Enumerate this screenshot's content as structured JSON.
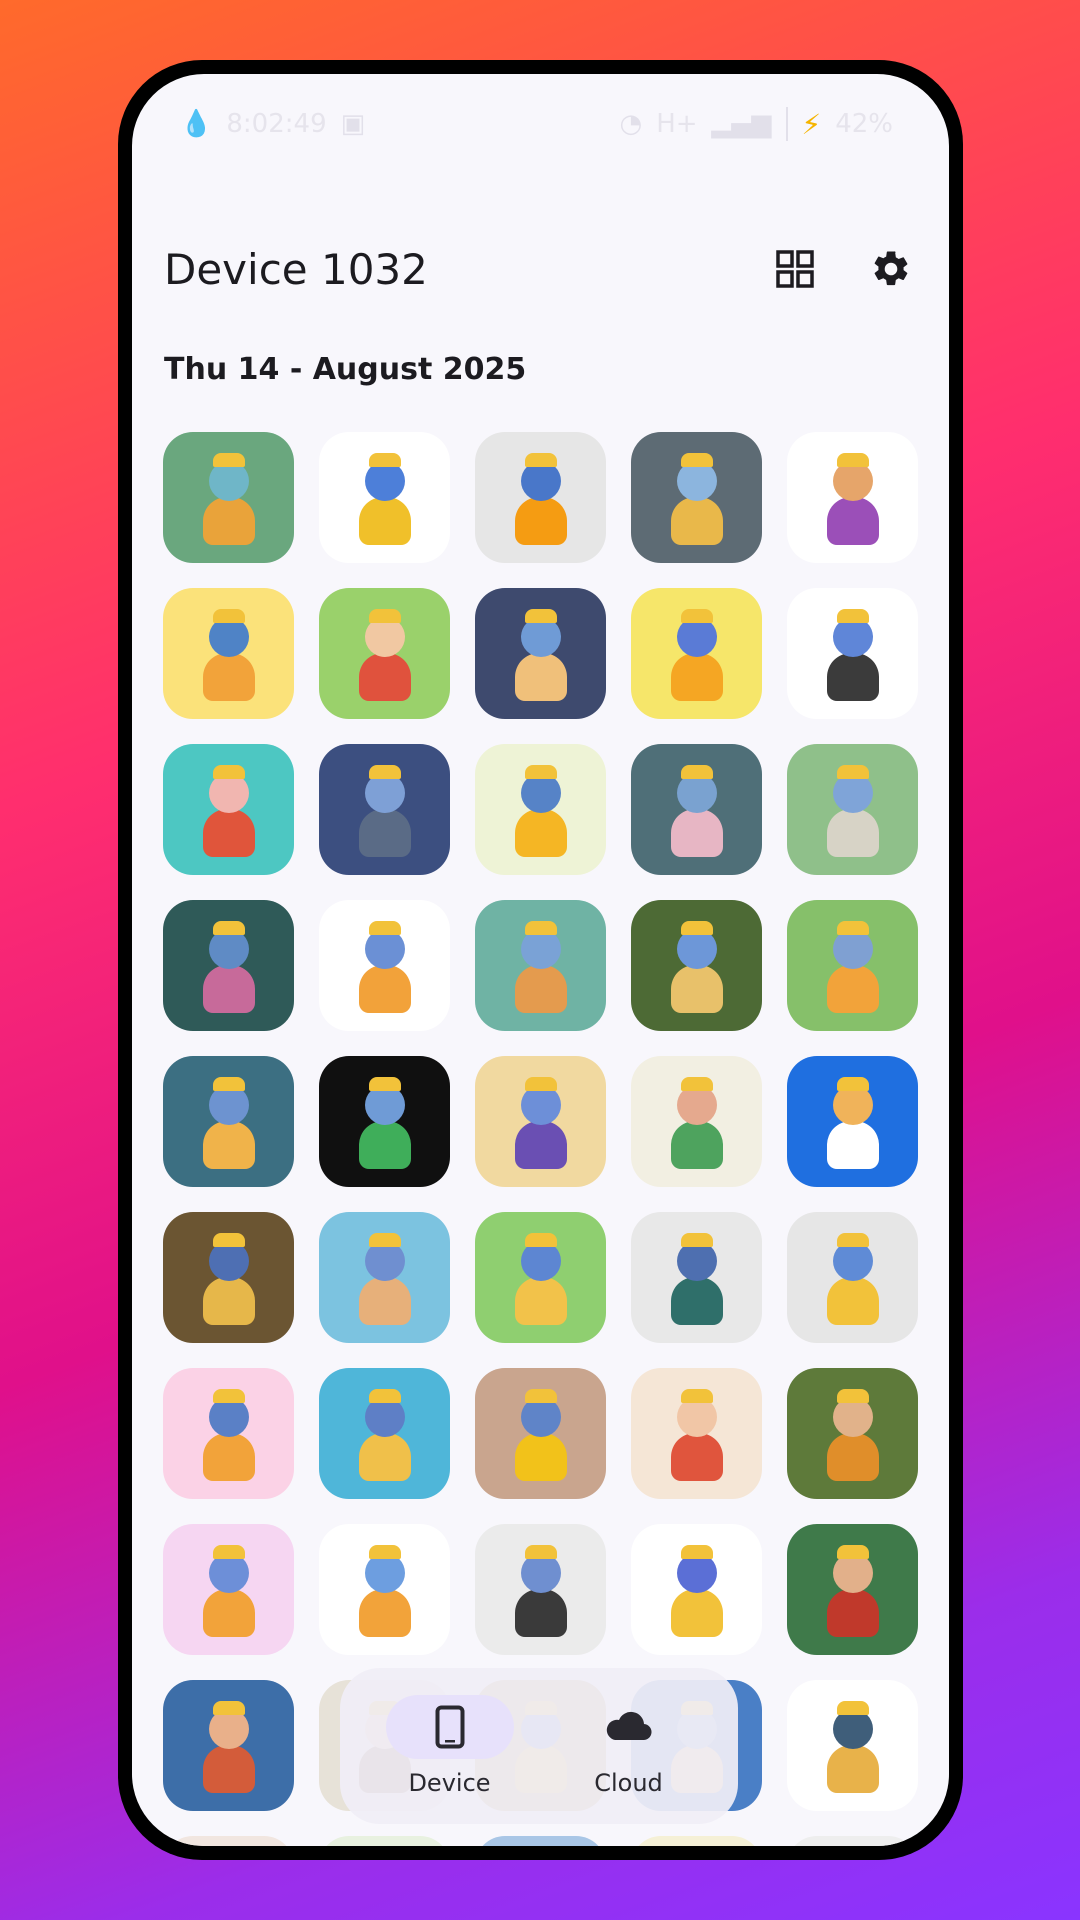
{
  "status_bar": {
    "time": "8:02:49",
    "network": "H+",
    "battery": "42%"
  },
  "app_bar": {
    "title": "Device 1032",
    "icons": [
      "grid-view-icon",
      "settings-gear-icon"
    ]
  },
  "date_group": {
    "header": "Thu 14 - August 2025"
  },
  "thumbnails": [
    {
      "bg": "#6aa77e",
      "skin": "#6fb6c8",
      "cloth": "#e9a33a"
    },
    {
      "bg": "#ffffff",
      "skin": "#4d7fd9",
      "cloth": "#f0c02a"
    },
    {
      "bg": "#e6e6e6",
      "skin": "#4977c9",
      "cloth": "#f59c12"
    },
    {
      "bg": "#5d6b74",
      "skin": "#8cb5de",
      "cloth": "#e9b84a"
    },
    {
      "bg": "#ffffff",
      "skin": "#e6a56a",
      "cloth": "#9b4fb8"
    },
    {
      "bg": "#fbe27a",
      "skin": "#4f83c6",
      "cloth": "#f2a33a"
    },
    {
      "bg": "#9ad16b",
      "skin": "#f1c8a2",
      "cloth": "#e0523d"
    },
    {
      "bg": "#3e4a6e",
      "skin": "#6f9bd6",
      "cloth": "#f0c07a"
    },
    {
      "bg": "#f6e66a",
      "skin": "#5a7bd6",
      "cloth": "#f5a623"
    },
    {
      "bg": "#ffffff",
      "skin": "#5f86d8",
      "cloth": "#3b3b3b"
    },
    {
      "bg": "#4dc7c2",
      "skin": "#f1b6b0",
      "cloth": "#e0553b"
    },
    {
      "bg": "#3c4f80",
      "skin": "#7ea0d6",
      "cloth": "#5a6b86"
    },
    {
      "bg": "#eef3d6",
      "skin": "#5683c7",
      "cloth": "#f5b624"
    },
    {
      "bg": "#4f6f78",
      "skin": "#7aa2d0",
      "cloth": "#e7b6c4"
    },
    {
      "bg": "#8fc08a",
      "skin": "#7fa4d8",
      "cloth": "#d7d3c6"
    },
    {
      "bg": "#2f5a58",
      "skin": "#5f8bc5",
      "cloth": "#c76a9a"
    },
    {
      "bg": "#ffffff",
      "skin": "#6b90d5",
      "cloth": "#f2a23a"
    },
    {
      "bg": "#6fb3a4",
      "skin": "#7aa2d6",
      "cloth": "#e49b4e"
    },
    {
      "bg": "#4d6a35",
      "skin": "#6d97d8",
      "cloth": "#e8c16a"
    },
    {
      "bg": "#86c06a",
      "skin": "#7fa0d2",
      "cloth": "#f2a33a"
    },
    {
      "bg": "#3c6f82",
      "skin": "#6d93d0",
      "cloth": "#f0b34a"
    },
    {
      "bg": "#101010",
      "skin": "#6f9bd6",
      "cloth": "#3fae5a"
    },
    {
      "bg": "#f1d9a0",
      "skin": "#6d8fd8",
      "cloth": "#6a4fb3"
    },
    {
      "bg": "#f2efe2",
      "skin": "#e5a98e",
      "cloth": "#4ea35e"
    },
    {
      "bg": "#1f6fe0",
      "skin": "#f0b35a",
      "cloth": "#ffffff"
    },
    {
      "bg": "#6b5532",
      "skin": "#4e6fb3",
      "cloth": "#e6b74a"
    },
    {
      "bg": "#7cc3e0",
      "skin": "#6f8fd0",
      "cloth": "#e7b07a"
    },
    {
      "bg": "#8fcf70",
      "skin": "#5d86d2",
      "cloth": "#f2c24a"
    },
    {
      "bg": "#e8e8e8",
      "skin": "#4e6fb0",
      "cloth": "#2f6f6a"
    },
    {
      "bg": "#e6e6e6",
      "skin": "#5f8bd6",
      "cloth": "#f2c23a"
    },
    {
      "bg": "#fbd2e6",
      "skin": "#5a80c6",
      "cloth": "#f2a33a"
    },
    {
      "bg": "#4fb6d9",
      "skin": "#5e7fc6",
      "cloth": "#f0c04a"
    },
    {
      "bg": "#c9a58e",
      "skin": "#5f84c8",
      "cloth": "#f2c21a"
    },
    {
      "bg": "#f5e6d6",
      "skin": "#f1c6a6",
      "cloth": "#e0553d"
    },
    {
      "bg": "#5e7a3a",
      "skin": "#e1b28a",
      "cloth": "#e08e2a"
    },
    {
      "bg": "#f6d6f2",
      "skin": "#6d8fd8",
      "cloth": "#f2a33a"
    },
    {
      "bg": "#ffffff",
      "skin": "#6d9ee0",
      "cloth": "#f2a33a"
    },
    {
      "bg": "#ebebeb",
      "skin": "#6f8fd0",
      "cloth": "#3a3a3a"
    },
    {
      "bg": "#ffffff",
      "skin": "#5b6fd6",
      "cloth": "#f2c23a"
    },
    {
      "bg": "#3f7a4a",
      "skin": "#e2b08a",
      "cloth": "#c0392b"
    },
    {
      "bg": "#3d6ea8",
      "skin": "#e9b08a",
      "cloth": "#d35c3a"
    },
    {
      "bg": "#e7e2d8",
      "skin": "#f0c8a8",
      "cloth": "#8f6b4a"
    },
    {
      "bg": "#c8a462",
      "skin": "#6f8fd0",
      "cloth": "#f2c23a"
    },
    {
      "bg": "#4a7fc6",
      "skin": "#7ea4d6",
      "cloth": "#f0c07a"
    },
    {
      "bg": "#ffffff",
      "skin": "#3f5e7a",
      "cloth": "#e8b24a"
    },
    {
      "bg": "#f1e6e0",
      "skin": "#f0c29a",
      "cloth": "#d94a6a"
    },
    {
      "bg": "#e8f1e0",
      "skin": "#5f84c8",
      "cloth": "#2f8a5a"
    },
    {
      "bg": "#a9c6e6",
      "skin": "#6f8fd0",
      "cloth": "#f2c23a"
    },
    {
      "bg": "#f5f0d6",
      "skin": "#6d9ee0",
      "cloth": "#f2a33a"
    },
    {
      "bg": "#eeeeee",
      "skin": "#f0c29a",
      "cloth": "#e0553d"
    }
  ],
  "bottom_nav": {
    "items": [
      {
        "label": "Device",
        "icon": "phone-icon",
        "active": true
      },
      {
        "label": "Cloud",
        "icon": "cloud-icon",
        "active": false
      }
    ]
  }
}
